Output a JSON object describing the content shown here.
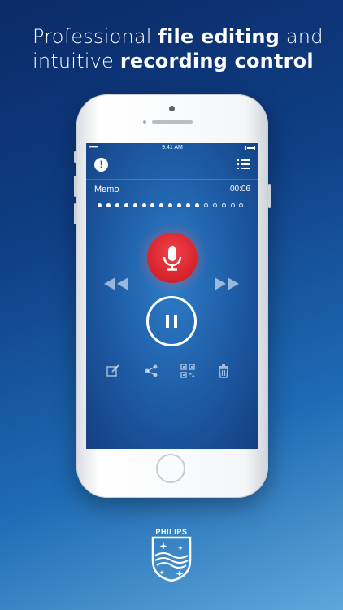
{
  "headline": {
    "line1_pre": "Professional ",
    "line1_bold": "file editing",
    "line1_post": " and",
    "line2_pre": "intuitive ",
    "line2_bold": "recording control"
  },
  "status_bar": {
    "signal": "•••••",
    "time": "9:41 AM"
  },
  "recording": {
    "file_name": "Memo",
    "duration": "00:06",
    "progress_filled": 12,
    "progress_total": 17
  },
  "toolbar": {
    "icons": [
      "edit-icon",
      "share-icon",
      "qr-code-icon",
      "trash-icon"
    ]
  },
  "brand": {
    "name": "PHILIPS"
  },
  "colors": {
    "record": "#d5222b",
    "screen": "#1d5aa3",
    "accent": "#ffffff"
  }
}
